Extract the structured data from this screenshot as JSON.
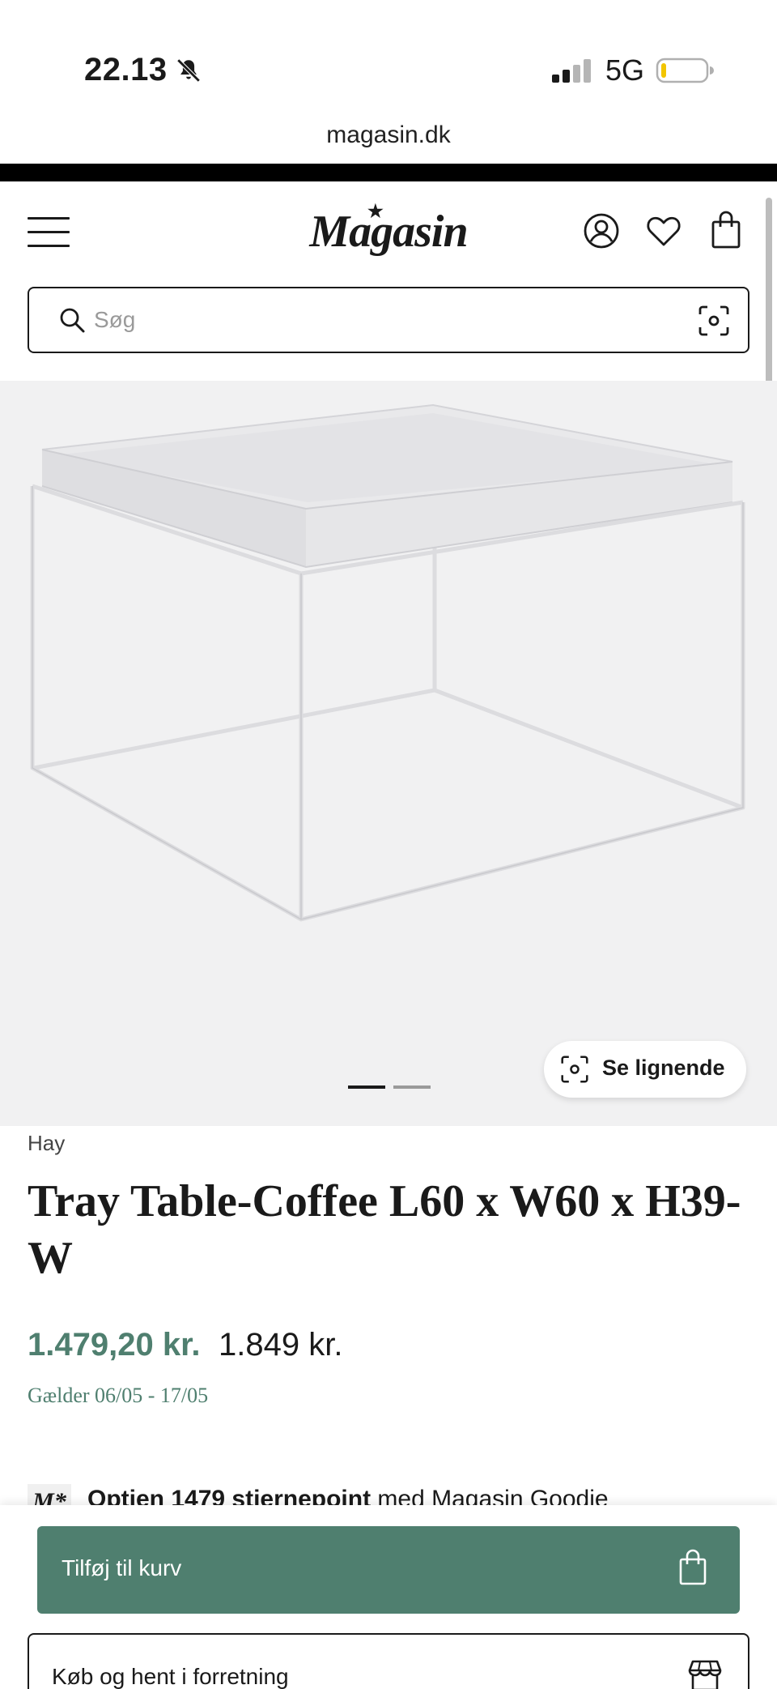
{
  "status_bar": {
    "time": "22.13",
    "network": "5G"
  },
  "browser": {
    "url": "magasin.dk"
  },
  "header": {
    "logo_text": "Magasin",
    "search_placeholder": "Søg"
  },
  "gallery": {
    "similar_label": "Se lignende",
    "slide_count": 2,
    "active_slide": 1
  },
  "product": {
    "brand": "Hay",
    "title": "Tray Table-Coffee L60 x W60 x H39-W",
    "sale_price": "1.479,20 kr.",
    "original_price": "1.849 kr.",
    "validity": "Gælder 06/05 - 17/05"
  },
  "points": {
    "logo": "M*",
    "strong_text": "Optjen 1479 stjernepoint",
    "rest_text": " med Magasin Goodie"
  },
  "actions": {
    "add_to_cart_label": "Tilføj til kurv",
    "pickup_label": "Køb og hent i forretning"
  },
  "colors": {
    "accent": "#4f7f6f",
    "gallery_bg": "#f1f1f2"
  }
}
